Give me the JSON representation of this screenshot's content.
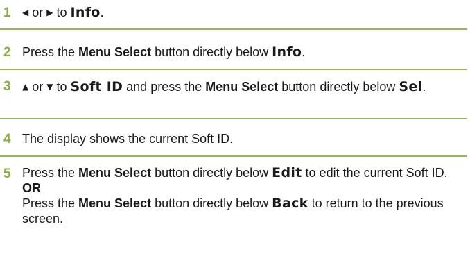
{
  "colors": {
    "step_number": "#8aab45",
    "rule": "#9ab35e",
    "text": "#1a1a1a"
  },
  "steps": [
    {
      "number": "1",
      "parts": {
        "left_arrow": "◀",
        "or": " or ",
        "right_arrow": "▶",
        "to": " to ",
        "info": "Info",
        "end": "."
      }
    },
    {
      "number": "2",
      "parts": {
        "press": "Press the ",
        "menu_select": "Menu Select",
        "below": " button directly below ",
        "info": "Info",
        "end": "."
      }
    },
    {
      "number": "3",
      "parts": {
        "up_arrow": "▲",
        "or": " or ",
        "down_arrow": "▼",
        "to": " to ",
        "soft_id": "Soft ID",
        "and_press": " and press the ",
        "menu_select": "Menu Select",
        "below": " button directly below ",
        "sel": "Sel",
        "end": "."
      }
    },
    {
      "number": "4",
      "text": "The display shows the current Soft ID."
    },
    {
      "number": "5",
      "parts": {
        "press": "Press the ",
        "menu_select": "Menu Select",
        "below": " button directly below ",
        "edit": "Edit",
        "edit_tail": " to edit the current Soft ID.",
        "or_label": "OR",
        "press2": "Press the ",
        "menu_select2": "Menu Select",
        "below2": " button directly below ",
        "back": "Back",
        "back_tail": " to return to the previous screen."
      }
    }
  ]
}
